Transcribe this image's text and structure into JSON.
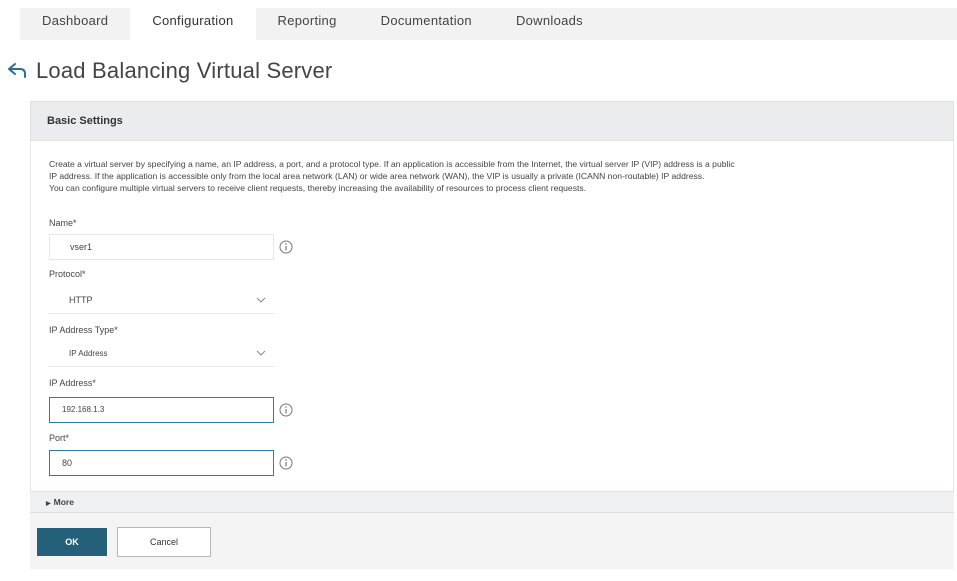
{
  "nav": {
    "tabs": [
      {
        "label": "Dashboard",
        "active": false
      },
      {
        "label": "Configuration",
        "active": true
      },
      {
        "label": "Reporting",
        "active": false
      },
      {
        "label": "Documentation",
        "active": false
      },
      {
        "label": "Downloads",
        "active": false
      }
    ]
  },
  "page": {
    "back_icon": "back-arrow-icon",
    "title": "Load Balancing Virtual Server"
  },
  "section": {
    "header": "Basic Settings",
    "description": [
      "Create a virtual server by specifying a name, an IP address, a port, and a protocol type. If an application is accessible from the Internet, the virtual server IP (VIP) address is a public",
      "IP address. If the application is accessible only from the local area network (LAN) or wide area network (WAN), the VIP is usually a private (ICANN non-routable) IP address.",
      "You can configure multiple virtual servers to receive client requests, thereby increasing the availability of resources to process client requests."
    ]
  },
  "form": {
    "name": {
      "label": "Name*",
      "value": "vser1"
    },
    "protocol": {
      "label": "Protocol*",
      "value": "HTTP"
    },
    "ip_address_type": {
      "label": "IP Address Type*",
      "value": "IP Address"
    },
    "ip_address": {
      "label": "IP Address*",
      "value": "192.168.1.3"
    },
    "port": {
      "label": "Port*",
      "value": "80"
    }
  },
  "more": {
    "label": "More"
  },
  "actions": {
    "ok_label": "OK",
    "cancel_label": "Cancel"
  },
  "colors": {
    "primary_button": "#25607a",
    "focus_border": "#2a7ba8"
  }
}
